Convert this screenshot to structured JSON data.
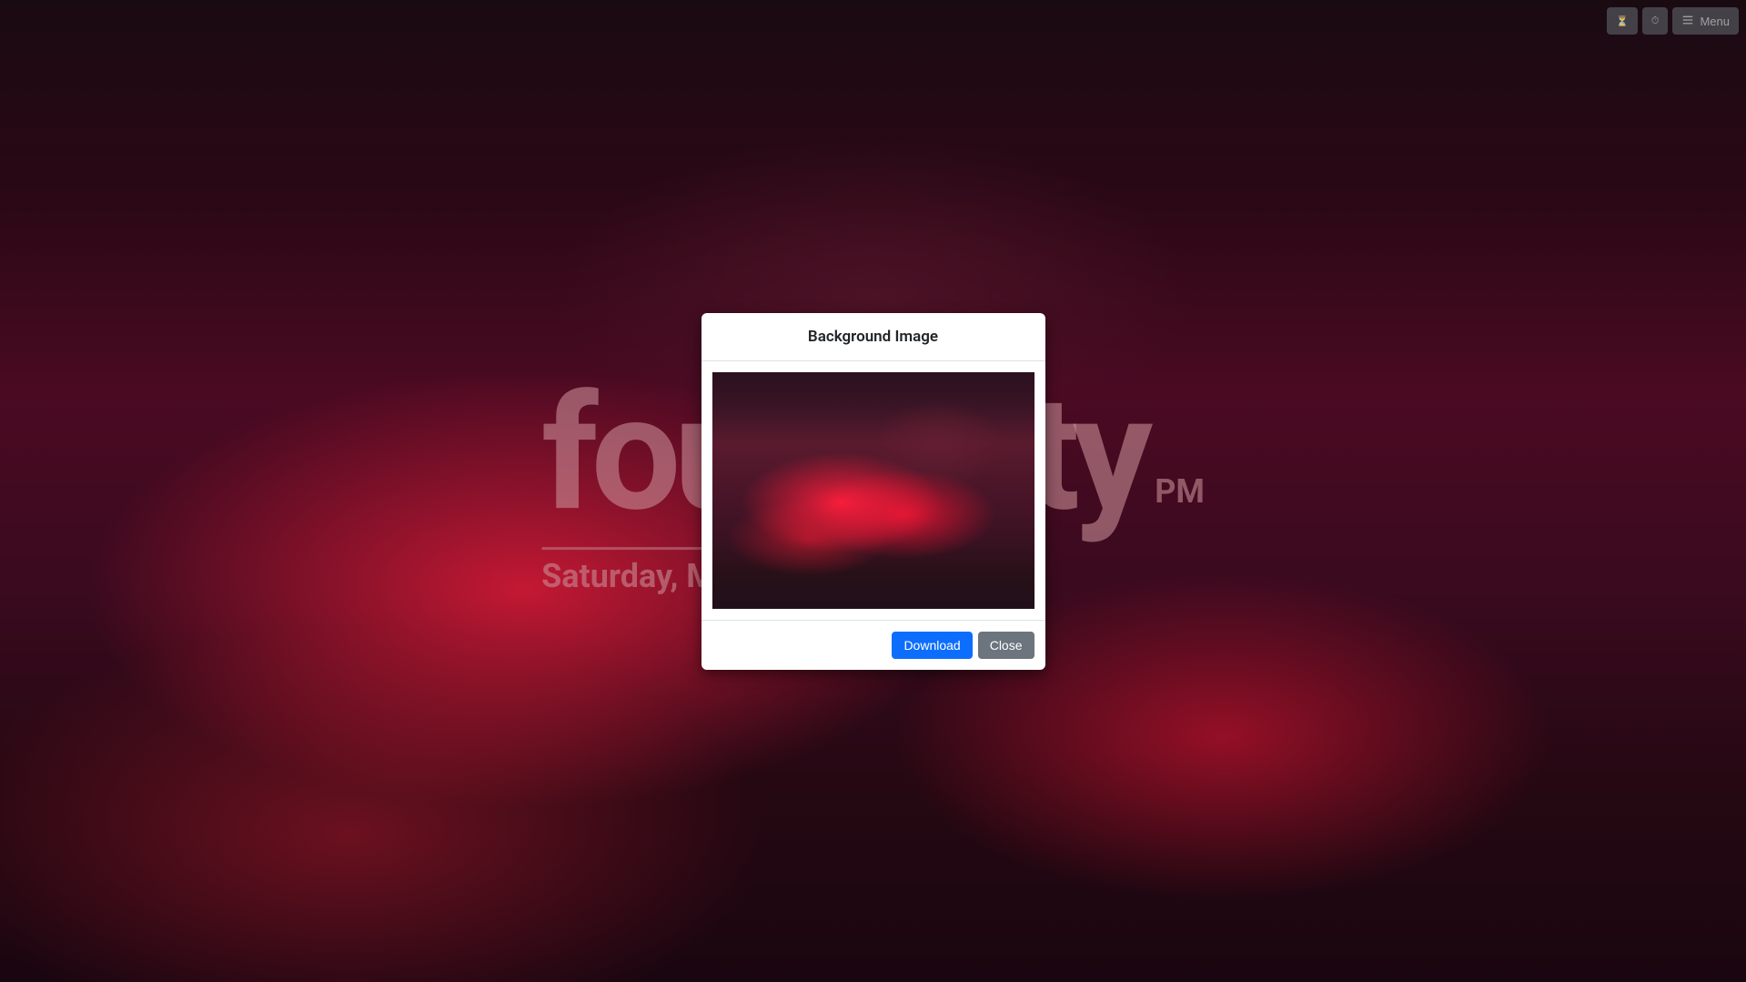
{
  "toolbar": {
    "hourglass_title": "Hourglass",
    "stopwatch_title": "Stopwatch",
    "menu_label": "Menu"
  },
  "clock": {
    "time_word_1": "four",
    "time_word_space": " ",
    "time_word_2": "forty",
    "ampm": "PM",
    "date": "Saturday, March"
  },
  "modal": {
    "title": "Background Image",
    "download_label": "Download",
    "close_label": "Close"
  }
}
